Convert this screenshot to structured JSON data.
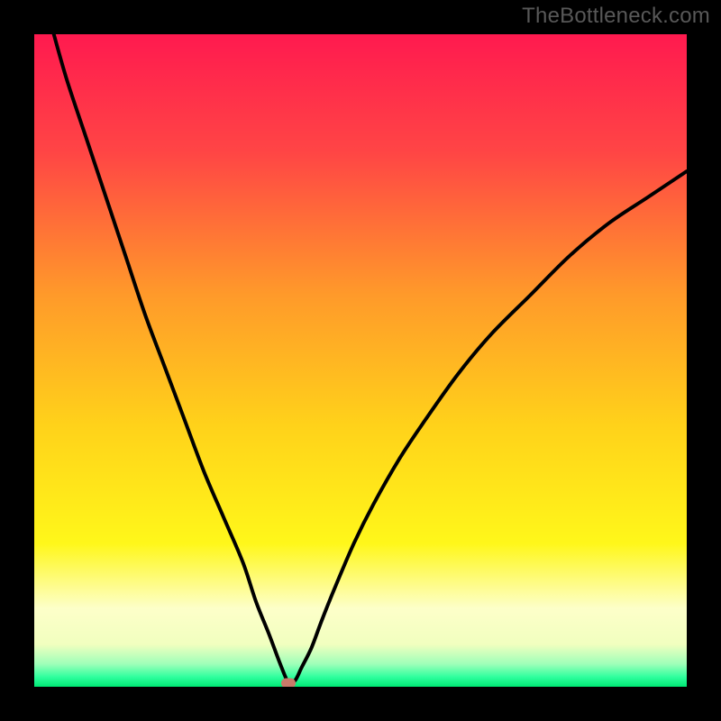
{
  "watermark": "TheBottleneck.com",
  "colors": {
    "frame_bg": "#000000",
    "curve_stroke": "#000000",
    "marker_fill": "#c97a6a",
    "gradient_stops": [
      {
        "pos": 0.0,
        "color": "#ff1a4f"
      },
      {
        "pos": 0.18,
        "color": "#ff4545"
      },
      {
        "pos": 0.4,
        "color": "#ff9a2a"
      },
      {
        "pos": 0.6,
        "color": "#ffd21a"
      },
      {
        "pos": 0.78,
        "color": "#fff71a"
      },
      {
        "pos": 0.88,
        "color": "#fdffc9"
      },
      {
        "pos": 0.935,
        "color": "#f1ffbf"
      },
      {
        "pos": 0.965,
        "color": "#9fffb9"
      },
      {
        "pos": 0.985,
        "color": "#2fff9e"
      },
      {
        "pos": 1.0,
        "color": "#00e874"
      }
    ]
  },
  "chart_data": {
    "type": "line",
    "title": "",
    "xlabel": "",
    "ylabel": "",
    "xlim": [
      0,
      100
    ],
    "ylim": [
      0,
      100
    ],
    "grid": false,
    "legend": false,
    "series": [
      {
        "name": "bottleneck-curve",
        "x": [
          3,
          5,
          8,
          11,
          14,
          17,
          20,
          23,
          26,
          29,
          32,
          34,
          36,
          37.5,
          38.5,
          39,
          40,
          41,
          42.5,
          44,
          46,
          49,
          52,
          56,
          60,
          65,
          70,
          76,
          82,
          88,
          94,
          100
        ],
        "y": [
          100,
          93,
          84,
          75,
          66,
          57,
          49,
          41,
          33,
          26,
          19,
          13,
          8,
          4,
          1.5,
          0.5,
          1,
          3,
          6,
          10,
          15,
          22,
          28,
          35,
          41,
          48,
          54,
          60,
          66,
          71,
          75,
          79
        ]
      }
    ],
    "annotations": [
      {
        "name": "min-marker",
        "x": 39,
        "y": 0.6
      }
    ]
  }
}
